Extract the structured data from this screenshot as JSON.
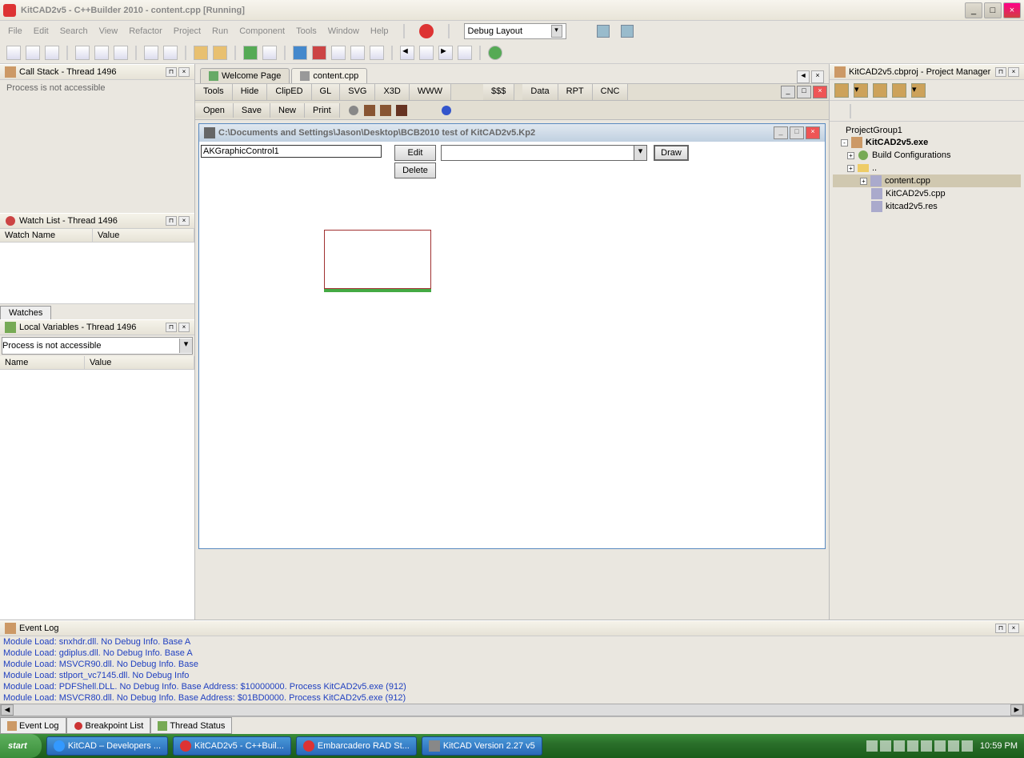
{
  "title": "KitCAD2v5 - C++Builder 2010 - content.cpp [Running]",
  "menu": [
    "File",
    "Edit",
    "Search",
    "View",
    "Refactor",
    "Project",
    "Run",
    "Component",
    "Tools",
    "Window",
    "Help"
  ],
  "layoutCombo": "Debug Layout",
  "panels": {
    "callstack": {
      "title": "Call Stack - Thread 1496",
      "body": "Process is not accessible"
    },
    "watch": {
      "title": "Watch List - Thread 1496",
      "cols": [
        "Watch Name",
        "Value"
      ],
      "tab": "Watches"
    },
    "locals": {
      "title": "Local Variables - Thread 1496",
      "combo": "Process is not accessible",
      "cols": [
        "Name",
        "Value"
      ]
    },
    "eventlog": {
      "title": "Event Log",
      "lines": [
        "Module Load: snxhdr.dll. No Debug Info. Base A",
        "Module Load: gdiplus.dll. No Debug Info. Base A",
        "Module Load: MSVCR90.dll. No Debug Info. Base",
        "Module Load: stlport_vc7145.dll. No Debug Info",
        "Module Load: PDFShell.DLL. No Debug Info. Base Address: $10000000. Process KitCAD2v5.exe (912)",
        "Module Load: MSVCR80.dll. No Debug Info. Base Address: $01BD0000. Process KitCAD2v5.exe (912)"
      ]
    }
  },
  "doctabs": [
    {
      "label": "Welcome Page"
    },
    {
      "label": "content.cpp"
    }
  ],
  "tooltabs": [
    "Tools",
    "Hide",
    "ClipED",
    "GL",
    "SVG",
    "X3D",
    "WWW",
    "$$$",
    "Data",
    "RPT",
    "CNC"
  ],
  "filebar": [
    "Open",
    "Save",
    "New",
    "Print"
  ],
  "childwin": {
    "title": "C:\\Documents and Settings\\Jason\\Desktop\\BCB2010 test of KitCAD2v5.Kp2",
    "input": "AKGraphicControl1",
    "btns": {
      "edit": "Edit",
      "delete": "Delete",
      "draw": "Draw"
    }
  },
  "projmgr": {
    "title": "KitCAD2v5.cbproj - Project Manager",
    "root": "ProjectGroup1",
    "items": [
      {
        "label": "KitCAD2v5.exe",
        "bold": true,
        "lvl": 1,
        "exp": "-"
      },
      {
        "label": "Build Configurations",
        "lvl": 2,
        "exp": "+"
      },
      {
        "label": "..",
        "lvl": 2,
        "exp": "+",
        "folder": true
      },
      {
        "label": "content.cpp",
        "lvl": 3,
        "exp": "+",
        "sel": true
      },
      {
        "label": "KitCAD2v5.cpp",
        "lvl": 3
      },
      {
        "label": "kitcad2v5.res",
        "lvl": 3
      }
    ]
  },
  "bottabs": [
    "Event Log",
    "Breakpoint List",
    "Thread Status"
  ],
  "taskbar": {
    "start": "start",
    "items": [
      "KitCAD – Developers ...",
      "KitCAD2v5 - C++Buil...",
      "Embarcadero RAD St...",
      "KitCAD Version 2.27 v5"
    ],
    "time": "10:59 PM"
  }
}
